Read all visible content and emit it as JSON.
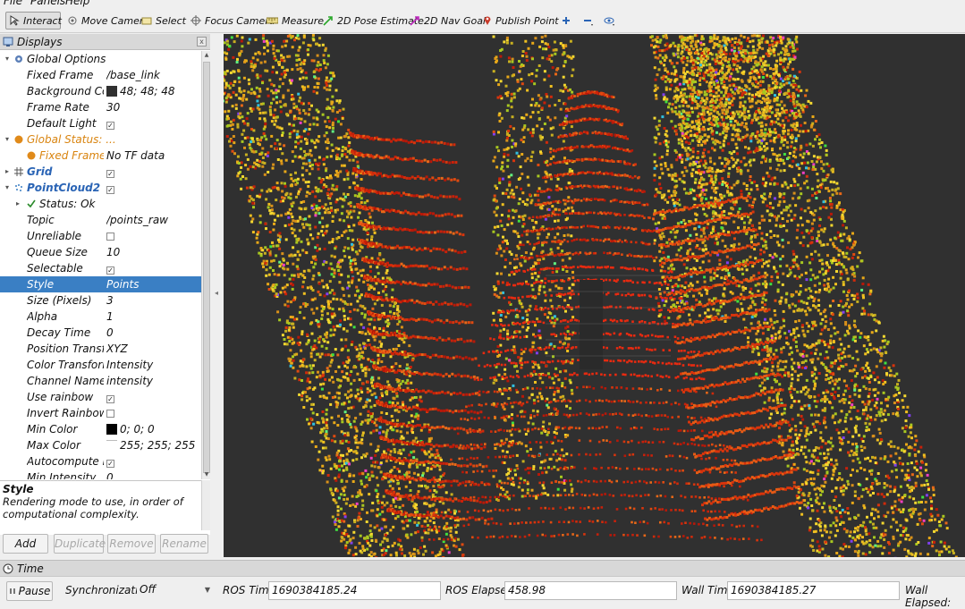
{
  "menu": {
    "file": "File",
    "panels": "Panels",
    "help": "Help"
  },
  "toolbar": {
    "interact": "Interact",
    "move_camera": "Move Camera",
    "select": "Select",
    "focus_camera": "Focus Camera",
    "measure": "Measure",
    "pose_estimate": "2D Pose Estimate",
    "nav_goal": "2D Nav Goal",
    "publish_point": "Publish Point"
  },
  "displays": {
    "title": "Displays",
    "close": "x",
    "rows": {
      "global_options": "Global Options",
      "fixed_frame_label": "Fixed Frame",
      "fixed_frame_value": "/base_link",
      "bg_color_label": "Background Color",
      "bg_color_value": "48; 48; 48",
      "frame_rate_label": "Frame Rate",
      "frame_rate_value": "30",
      "default_light_label": "Default Light",
      "global_status": "Global Status: ...",
      "fixed_frame_status_label": "Fixed Frame",
      "fixed_frame_status_value": "No TF data",
      "grid": "Grid",
      "pointcloud": "PointCloud2",
      "status_ok": "Status: Ok",
      "topic_label": "Topic",
      "topic_value": "/points_raw",
      "unreliable_label": "Unreliable",
      "queue_size_label": "Queue Size",
      "queue_size_value": "10",
      "selectable_label": "Selectable",
      "style_label": "Style",
      "style_value": "Points",
      "size_label": "Size (Pixels)",
      "size_value": "3",
      "alpha_label": "Alpha",
      "alpha_value": "1",
      "decay_label": "Decay Time",
      "decay_value": "0",
      "pos_tf_label": "Position Transfo...",
      "pos_tf_value": "XYZ",
      "color_tf_label": "Color Transformer",
      "color_tf_value": "Intensity",
      "channel_label": "Channel Name",
      "channel_value": "intensity",
      "rainbow_label": "Use rainbow",
      "invert_label": "Invert Rainbow",
      "min_color_label": "Min Color",
      "min_color_value": "0; 0; 0",
      "max_color_label": "Max Color",
      "max_color_value": "255; 255; 255",
      "autocompute_label": "Autocompute In...",
      "min_int_label": "Min Intensity",
      "min_int_value": "0"
    },
    "check": "✓"
  },
  "description": {
    "heading": "Style",
    "text": "Rendering mode to use, in order of computational complexity."
  },
  "buttons": {
    "add": "Add",
    "duplicate": "Duplicate",
    "remove": "Remove",
    "rename": "Rename"
  },
  "time": {
    "title": "Time",
    "pause": "Pause",
    "sync_label": "Synchronization:",
    "sync_value": "Off",
    "ros_time_label": "ROS Time:",
    "ros_time_value": "1690384185.24",
    "ros_elapsed_label": "ROS Elapsed:",
    "ros_elapsed_value": "458.98",
    "wall_time_label": "Wall Time:",
    "wall_time_value": "1690384185.27",
    "wall_elapsed_label": "Wall Elapsed:"
  },
  "colors": {
    "background": "#303030",
    "selection": "#3a7fc4",
    "min_color": "#000000",
    "max_color": "#ffffff"
  }
}
